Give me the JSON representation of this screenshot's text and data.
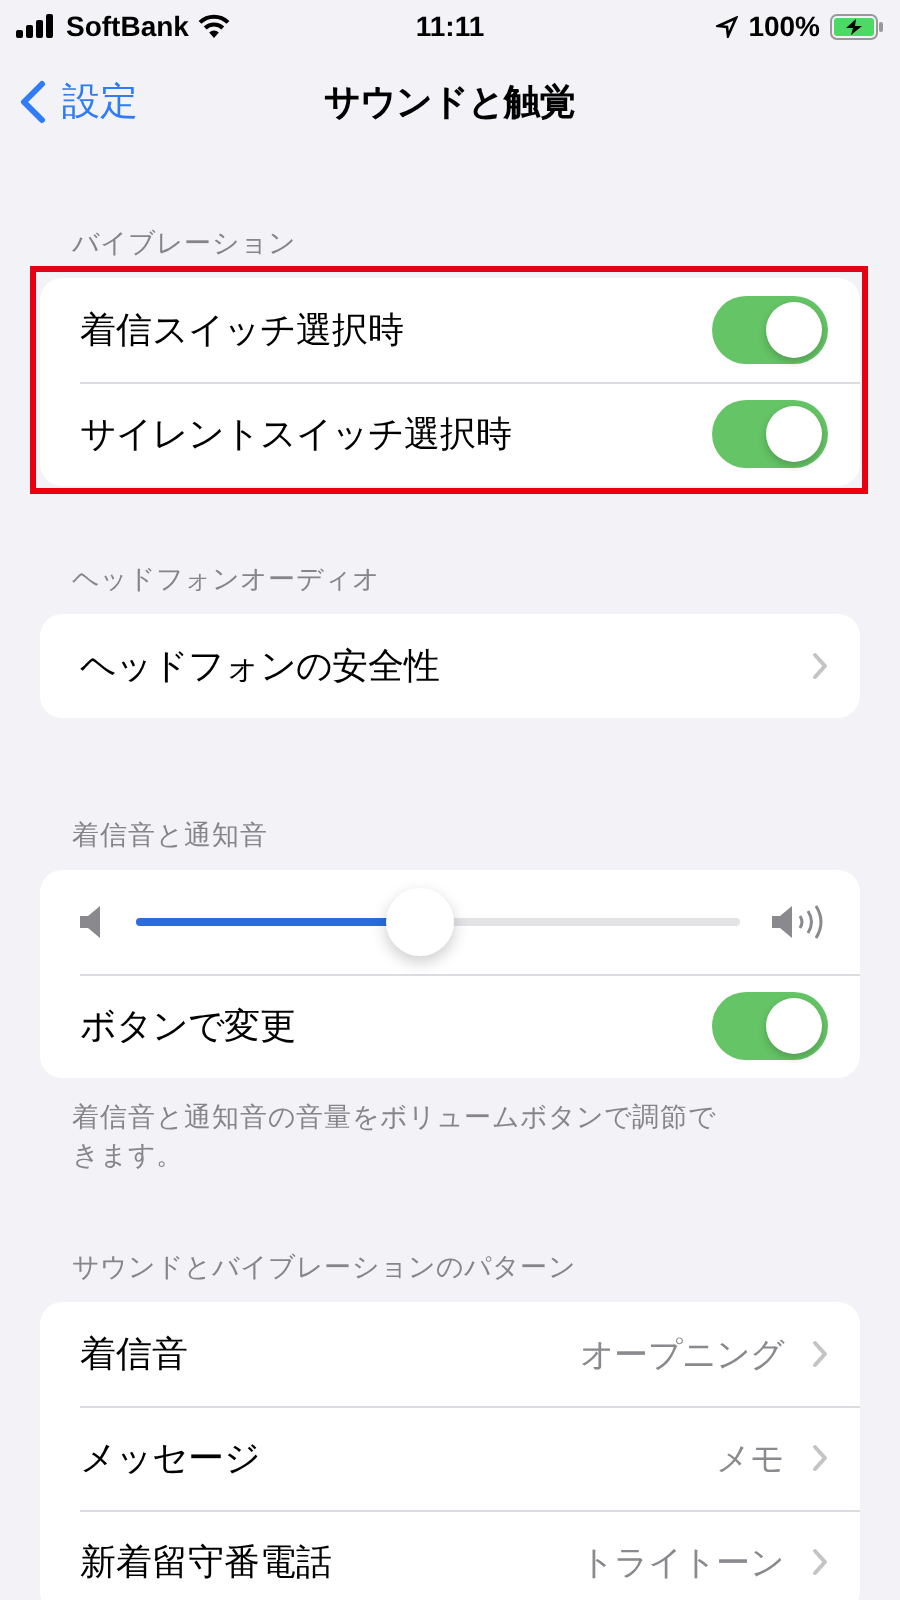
{
  "status_bar": {
    "carrier": "SoftBank",
    "time": "11:11",
    "battery": "100%",
    "charging": true
  },
  "nav": {
    "back": "設定",
    "title": "サウンドと触覚"
  },
  "sections": [
    {
      "header": "バイブレーション",
      "highlighted": true,
      "rows": [
        {
          "kind": "toggle",
          "label": "着信スイッチ選択時",
          "on": true
        },
        {
          "kind": "toggle",
          "label": "サイレントスイッチ選択時",
          "on": true
        }
      ]
    },
    {
      "header": "ヘッドフォンオーディオ",
      "highlighted": false,
      "rows": [
        {
          "kind": "link",
          "label": "ヘッドフォンの安全性"
        }
      ]
    },
    {
      "header": "着信音と通知音",
      "highlighted": false,
      "rows": [
        {
          "kind": "slider",
          "level": 0.47
        },
        {
          "kind": "toggle",
          "label": "ボタンで変更",
          "on": true
        }
      ],
      "footer": "着信音と通知音の音量をボリュームボタンで調節できます。"
    },
    {
      "header": "サウンドとバイブレーションのパターン",
      "highlighted": false,
      "rows": [
        {
          "kind": "link",
          "label": "着信音",
          "value": "オープニング"
        },
        {
          "kind": "link",
          "label": "メッセージ",
          "value": "メモ"
        },
        {
          "kind": "link",
          "label": "新着留守番電話",
          "value": "トライトーン"
        }
      ]
    }
  ]
}
